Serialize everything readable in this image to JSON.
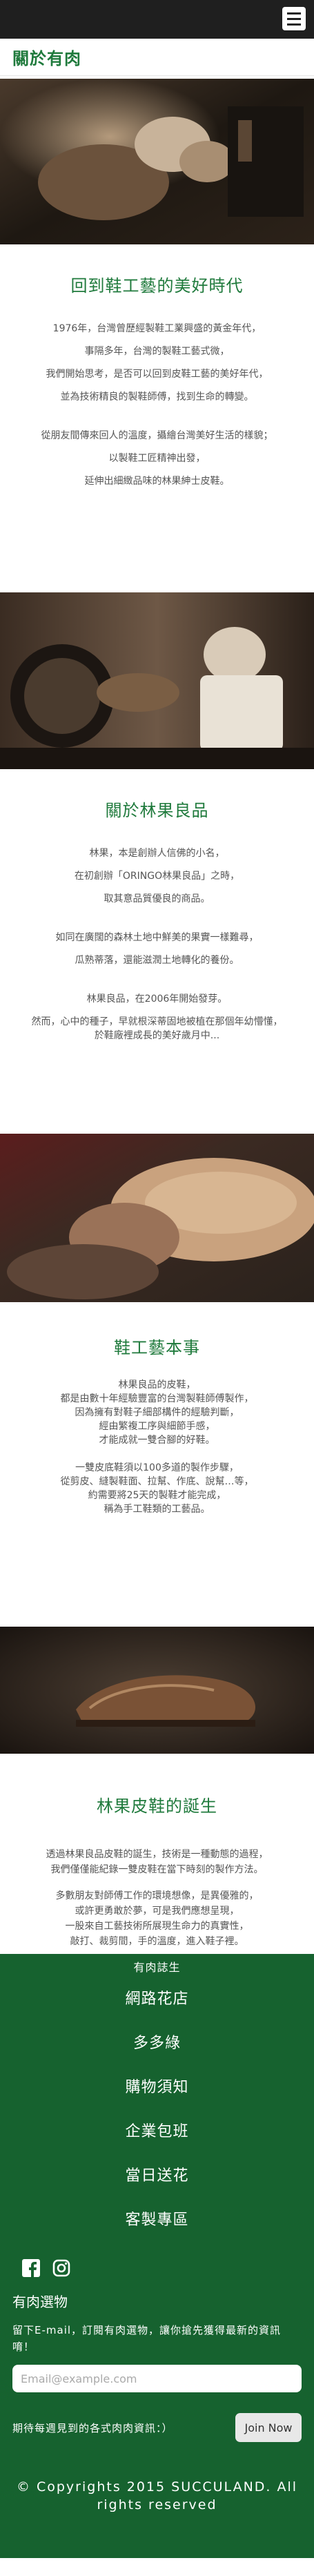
{
  "header": {
    "menu_icon": "hamburger-icon"
  },
  "page_title": "關於有肉",
  "sections": [
    {
      "title": "回到鞋工藝的美好時代",
      "paragraphs": [
        "1976年，台灣曾歷經製鞋工業興盛的黃金年代，",
        "事隔多年，台灣的製鞋工藝式微，",
        "我們開始思考，是否可以回到皮鞋工藝的美好年代，",
        "並為技術精良的製鞋師傅，找到生命的轉變。",
        "從朋友間傳來回人的溫度，攝繪台灣美好生活的樣貌；",
        "以製鞋工匠精神出發，",
        "延伸出細緻品味的林果紳士皮鞋。"
      ]
    },
    {
      "title": "關於林果良品",
      "paragraphs": [
        "林果，本是創辦人信佛的小名，",
        "在初創辦「ORINGO林果良品」之時，",
        "取其意品質優良的商品。",
        "如同在廣闊的森林土地中鮮美的果實一樣難尋，",
        "瓜熟蒂落，還能滋潤土地轉化的養份。",
        "林果良品，在2006年開始發芽。",
        "然而，心中的種子，早就根深蒂固地被植在那個年幼懵懂，",
        "於鞋廠裡成長的美好歲月中..."
      ]
    },
    {
      "title": "鞋工藝本事",
      "paragraphs": [
        "林果良品的皮鞋，",
        "都是由數十年經驗豐富的台灣製鞋師傅製作，",
        "因為擁有對鞋子細部構件的經驗判斷，",
        "經由繁複工序與細節手感，",
        "才能成就一雙合腳的好鞋。",
        "一雙皮底鞋須以100多道的製作步驟，",
        "從剪皮、縫製鞋面、拉幫、作底、說幫…等，",
        "約需要將25天的製鞋才能完成，",
        "稱為手工鞋類的工藝品。"
      ]
    },
    {
      "title": "林果皮鞋的誕生",
      "paragraphs": [
        "透過林果良品皮鞋的誕生，技術是一種動態的過程，",
        "我們僅僅能紀錄一雙皮鞋在當下時刻的製作方法。",
        "多數朋友對師傅工作的環境想像，是異優雅的，",
        "或許更勇敢於夢，可是我們應想呈現，",
        "一股來自工藝技術所展現生命力的真實性，",
        "敲打、裁剪間，手的溫度，進入鞋子裡。"
      ]
    }
  ],
  "footer": {
    "nav": [
      "有肉誌生",
      "網路花店",
      "多多綠",
      "購物須知",
      "企業包班",
      "當日送花",
      "客製專區"
    ],
    "social": [
      "facebook-icon",
      "instagram-icon"
    ],
    "newsletter": {
      "title": "有肉選物",
      "desc": "留下E-mail，訂閱有肉選物，讓你搶先獲得最新的資訊唷！",
      "email_placeholder": "Email@example.com",
      "lead": "期待每週見到的各式肉肉資訊：）",
      "join_label": "Join Now"
    },
    "copyright": "© Copyrights 2015 SUCCULAND. All rights reserved"
  },
  "colors": {
    "brand_green": "#1f7a3c",
    "footer_green": "#16622f",
    "topbar": "#1f1f1f"
  }
}
